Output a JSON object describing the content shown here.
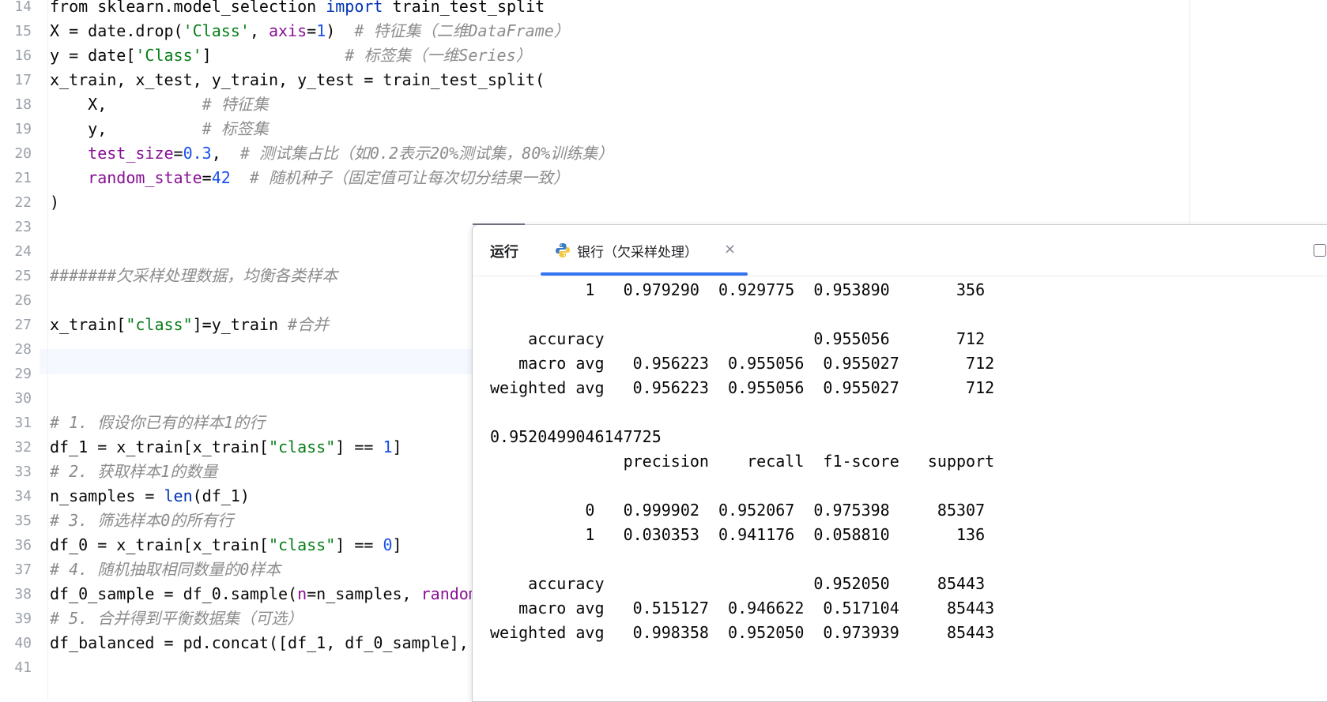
{
  "editor": {
    "line_numbers": [
      "14",
      "15",
      "16",
      "17",
      "18",
      "19",
      "20",
      "21",
      "22",
      "23",
      "24",
      "25",
      "26",
      "27",
      "28",
      "29",
      "30",
      "31",
      "32",
      "33",
      "34",
      "35",
      "36",
      "37",
      "38",
      "39",
      "40",
      "41"
    ],
    "lines": [
      [
        {
          "t": "from sklearn.model_selection ",
          "c": "p"
        },
        {
          "t": "import",
          "c": "kw"
        },
        {
          "t": " train_test_split",
          "c": "p"
        }
      ],
      [
        {
          "t": "X = date.drop(",
          "c": "p"
        },
        {
          "t": "'Class'",
          "c": "str"
        },
        {
          "t": ", ",
          "c": "p"
        },
        {
          "t": "axis",
          "c": "param"
        },
        {
          "t": "=",
          "c": "p"
        },
        {
          "t": "1",
          "c": "num"
        },
        {
          "t": ")  ",
          "c": "p"
        },
        {
          "t": "# 特征集（二维DataFrame）",
          "c": "cmt"
        }
      ],
      [
        {
          "t": "y = date[",
          "c": "p"
        },
        {
          "t": "'Class'",
          "c": "str"
        },
        {
          "t": "]              ",
          "c": "p"
        },
        {
          "t": "# 标签集（一维Series）",
          "c": "cmt"
        }
      ],
      [
        {
          "t": "x_train, x_test, y_train, y_test = train_test_split(",
          "c": "p"
        }
      ],
      [
        {
          "t": "    X,          ",
          "c": "p"
        },
        {
          "t": "# 特征集",
          "c": "cmt"
        }
      ],
      [
        {
          "t": "    y,          ",
          "c": "p"
        },
        {
          "t": "# 标签集",
          "c": "cmt"
        }
      ],
      [
        {
          "t": "    ",
          "c": "p"
        },
        {
          "t": "test_size",
          "c": "param"
        },
        {
          "t": "=",
          "c": "p"
        },
        {
          "t": "0.3",
          "c": "num"
        },
        {
          "t": ",  ",
          "c": "p"
        },
        {
          "t": "# 测试集占比（如0.2表示20%测试集，80%训练集）",
          "c": "cmt"
        }
      ],
      [
        {
          "t": "    ",
          "c": "p"
        },
        {
          "t": "random_state",
          "c": "param"
        },
        {
          "t": "=",
          "c": "p"
        },
        {
          "t": "42",
          "c": "num"
        },
        {
          "t": "  ",
          "c": "p"
        },
        {
          "t": "# 随机种子（固定值可让每次切分结果一致）",
          "c": "cmt"
        }
      ],
      [
        {
          "t": ")",
          "c": "p"
        }
      ],
      [],
      [],
      [
        {
          "t": "#######欠采样处理数据，均衡各类样本",
          "c": "cmt"
        }
      ],
      [],
      [
        {
          "t": "x_train[",
          "c": "p"
        },
        {
          "t": "\"class\"",
          "c": "str"
        },
        {
          "t": "]=y_train ",
          "c": "p"
        },
        {
          "t": "#合并",
          "c": "cmt"
        }
      ],
      [],
      [],
      [],
      [
        {
          "t": "# 1. 假设你已有的样本1的行",
          "c": "cmt"
        }
      ],
      [
        {
          "t": "df_1 = x_train[x_train[",
          "c": "p"
        },
        {
          "t": "\"class\"",
          "c": "str"
        },
        {
          "t": "] == ",
          "c": "p"
        },
        {
          "t": "1",
          "c": "num"
        },
        {
          "t": "]",
          "c": "p"
        }
      ],
      [
        {
          "t": "# 2. 获取样本1的数量",
          "c": "cmt"
        }
      ],
      [
        {
          "t": "n_samples = ",
          "c": "p"
        },
        {
          "t": "len",
          "c": "kw"
        },
        {
          "t": "(df_1)",
          "c": "p"
        }
      ],
      [
        {
          "t": "# 3. 筛选样本0的所有行",
          "c": "cmt"
        }
      ],
      [
        {
          "t": "df_0 = x_train[x_train[",
          "c": "p"
        },
        {
          "t": "\"class\"",
          "c": "str"
        },
        {
          "t": "] == ",
          "c": "p"
        },
        {
          "t": "0",
          "c": "num"
        },
        {
          "t": "]",
          "c": "p"
        }
      ],
      [
        {
          "t": "# 4. 随机抽取相同数量的0样本",
          "c": "cmt"
        }
      ],
      [
        {
          "t": "df_0_sample = df_0.sample(",
          "c": "p"
        },
        {
          "t": "n",
          "c": "param"
        },
        {
          "t": "=n_samples, ",
          "c": "p"
        },
        {
          "t": "random",
          "c": "param"
        }
      ],
      [
        {
          "t": "# 5. 合并得到平衡数据集（可选）",
          "c": "cmt"
        }
      ],
      [
        {
          "t": "df_balanced = pd.concat([df_1, df_0_sample], ",
          "c": "p"
        }
      ],
      []
    ]
  },
  "run_panel": {
    "title": "运行",
    "tab_label": "银行（欠采样处理）",
    "close_glyph": "×",
    "output_lines": [
      "          1   0.979290  0.929775  0.953890       356",
      "",
      "    accuracy                      0.955056       712",
      "   macro avg   0.956223  0.955056  0.955027       712",
      "weighted avg   0.956223  0.955056  0.955027       712",
      "",
      "0.9520499046147725",
      "              precision    recall  f1-score   support",
      "",
      "          0   0.999902  0.952067  0.975398     85307",
      "          1   0.030353  0.941176  0.058810       136",
      "",
      "    accuracy                      0.952050     85443",
      "   macro avg   0.515127  0.946622  0.517104     85443",
      "weighted avg   0.998358  0.952050  0.973939     85443"
    ]
  },
  "colors": {
    "keyword": "#0033b3",
    "string": "#067d17",
    "number": "#1750eb",
    "param": "#871094",
    "comment": "#8c8c8c",
    "tab_accent": "#3574f0"
  },
  "icons": {
    "tab_icon": "python-icon",
    "close_icon": "close-icon",
    "toolbar_icon": "layout-icon"
  }
}
